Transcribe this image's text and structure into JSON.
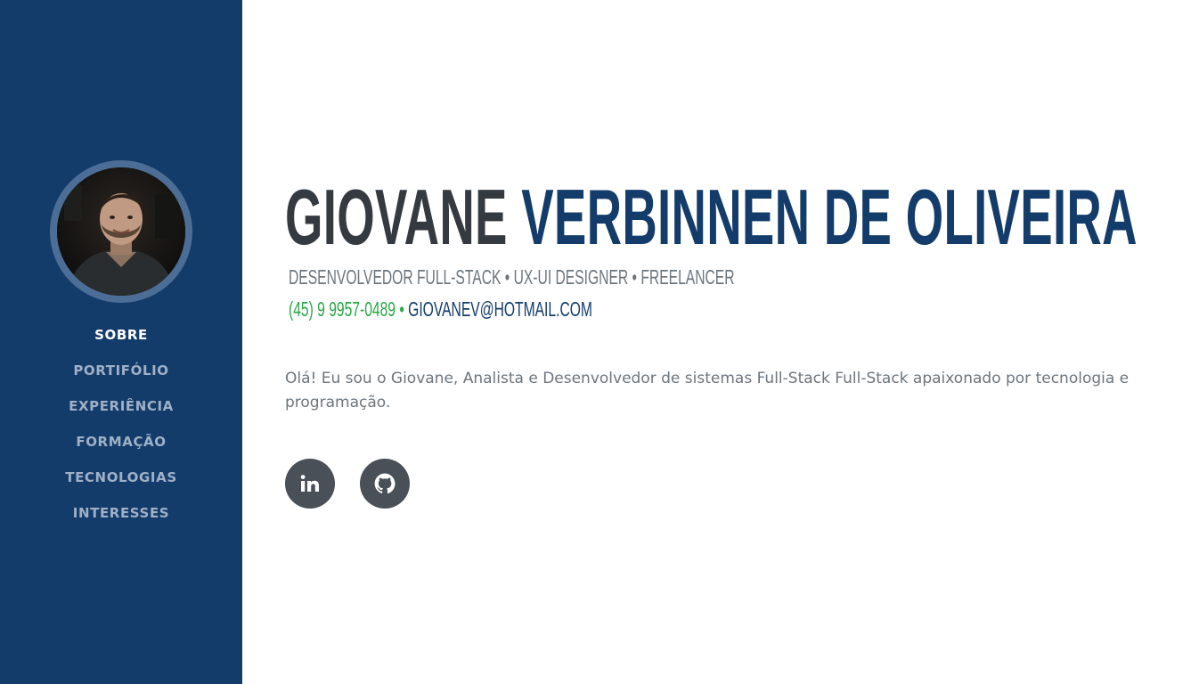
{
  "sidebar": {
    "avatar_alt": "Giovane",
    "nav": [
      {
        "label": "SOBRE",
        "active": true
      },
      {
        "label": "PORTIFÓLIO",
        "active": false
      },
      {
        "label": "EXPERIÊNCIA",
        "active": false
      },
      {
        "label": "FORMAÇÃO",
        "active": false
      },
      {
        "label": "TECNOLOGIAS",
        "active": false
      },
      {
        "label": "INTERESSES",
        "active": false
      }
    ]
  },
  "header": {
    "first_name": "GIOVANE",
    "last_name": "VERBINNEN DE OLIVEIRA",
    "subheading": "DESENVOLVEDOR FULL-STACK • UX-UI DESIGNER • FREELANCER",
    "phone": "(45) 9 9957-0489",
    "separator": " • ",
    "email": "GIOVANEV@HOTMAIL.COM"
  },
  "bio": "Olá! Eu sou o Giovane, Analista e Desenvolvedor de sistemas Full-Stack Full-Stack apaixonado por tecnologia e programação.",
  "socials": [
    {
      "icon": "linkedin-icon"
    },
    {
      "icon": "github-icon"
    }
  ],
  "colors": {
    "sidebar_bg": "#133c6a",
    "name_first": "#343a40",
    "name_last": "#133c6a",
    "phone": "#28a745",
    "social_bg": "#495057"
  }
}
